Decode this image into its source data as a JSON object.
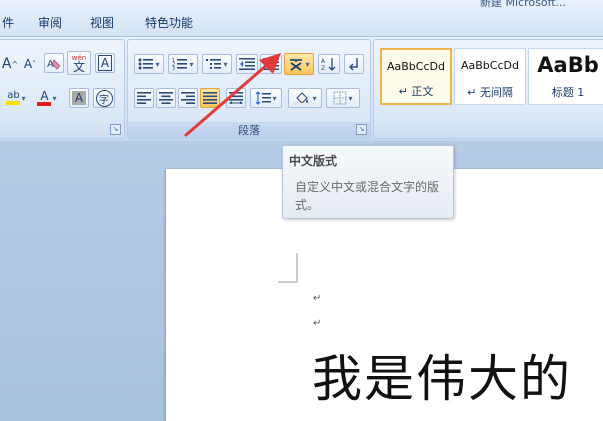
{
  "menu": {
    "title_fragment": "新建 Microsoft...",
    "items": [
      "件",
      "审阅",
      "视图",
      "特色功能"
    ]
  },
  "font_group": {
    "grow_font": "A",
    "shrink_font": "A",
    "phonetic": "wén",
    "phonetic_char": "文",
    "border_char": "A",
    "highlight_label": "ab",
    "font_color_label": "A",
    "shading_char": "A",
    "enclose_char": "字",
    "launcher": "↘"
  },
  "paragraph_group": {
    "label": "段落",
    "launcher": "↘"
  },
  "styles_group": {
    "styles": [
      {
        "sample": "AaBbCcDd",
        "name": "↵ 正文"
      },
      {
        "sample": "AaBbCcDd",
        "name": "↵ 无间隔"
      },
      {
        "sample": "AaBb",
        "name": "标题 1"
      }
    ]
  },
  "tooltip": {
    "title": "中文版式",
    "description": "自定义中文或混合文字的版式。"
  },
  "document": {
    "para_mark": "↵",
    "text": "我是伟大的"
  },
  "colors": {
    "highlight": "#f7e000",
    "font_color": "#e02020",
    "arrow": "#e23b3b",
    "selected_style_border": "#f0b44c"
  }
}
